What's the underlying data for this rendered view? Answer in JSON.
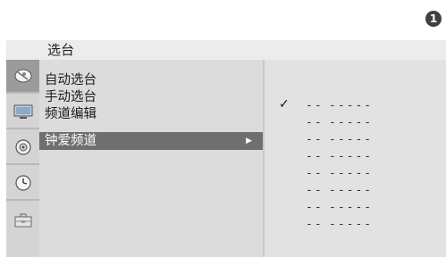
{
  "step_badge": "1",
  "menu": {
    "title": "选台",
    "items": [
      {
        "label": "自动选台"
      },
      {
        "label": "手动选台"
      },
      {
        "label": "频道编辑"
      },
      {
        "label": "钟爱频道",
        "selected": true,
        "arrow": "▶"
      }
    ]
  },
  "sidebar_icons": [
    "satellite-dish-icon",
    "tv-screen-icon",
    "speaker-icon",
    "clock-icon",
    "toolbox-icon"
  ],
  "favorites": {
    "check_mark": "✓",
    "rows": [
      {
        "a": "--",
        "b": "-----",
        "checked": true
      },
      {
        "a": "--",
        "b": "-----"
      },
      {
        "a": "--",
        "b": "-----"
      },
      {
        "a": "--",
        "b": "-----"
      },
      {
        "a": "--",
        "b": "-----"
      },
      {
        "a": "--",
        "b": "-----"
      },
      {
        "a": "--",
        "b": "-----"
      },
      {
        "a": "--",
        "b": "-----"
      }
    ]
  }
}
